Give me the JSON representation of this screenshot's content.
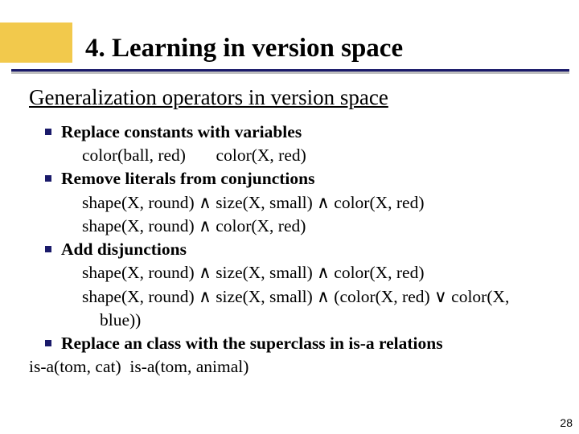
{
  "title": "4. Learning in version space",
  "subtitle": "Generalization operators in version space",
  "bullets": [
    {
      "heading": "Replace constants with variables",
      "lines": [
        "color(ball, red)       color(X, red)"
      ]
    },
    {
      "heading": "Remove literals from conjunctions",
      "lines": [
        "shape(X, round) ∧ size(X, small) ∧ color(X, red)",
        "shape(X, round) ∧ color(X, red)"
      ]
    },
    {
      "heading": "Add disjunctions",
      "lines": [
        "shape(X, round) ∧ size(X, small) ∧ color(X, red)",
        "shape(X, round) ∧ size(X, small) ∧ (color(X, red) ∨ color(X,"
      ],
      "cont": "blue))"
    },
    {
      "heading": "Replace an class with the superclass in is-a relations",
      "tail": "is-a(tom, cat)  is-a(tom, animal)"
    }
  ],
  "page": "28"
}
